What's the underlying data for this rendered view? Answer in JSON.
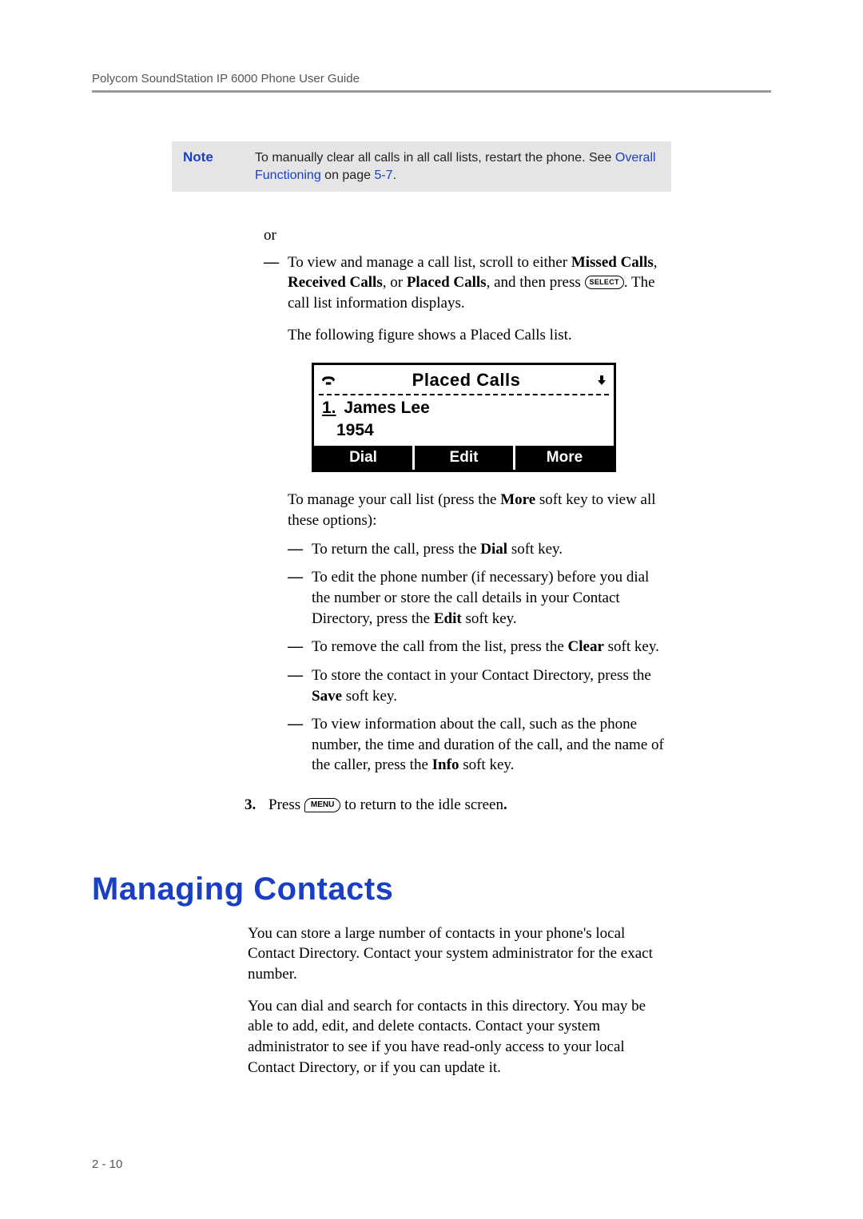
{
  "header": "Polycom SoundStation IP 6000 Phone User Guide",
  "note": {
    "label": "Note",
    "text_part1": "To manually clear all calls in all call lists, restart the phone. See ",
    "link1": "Overall Functioning",
    "text_part2": " on page ",
    "link2": "5-7",
    "text_part3": "."
  },
  "or_text": "or",
  "dash1": {
    "part1": "To view and manage a call list, scroll to either ",
    "b1": "Missed Calls",
    "part2": ", ",
    "b2": "Received Calls",
    "part3": ", or ",
    "b3": "Placed Calls",
    "part4": ", and then press ",
    "select_key": "SELECT",
    "part5": ". The call list information displays."
  },
  "fig_intro": "The following figure shows a Placed Calls list.",
  "screen": {
    "title": "Placed Calls",
    "entry_index": "1.",
    "entry_name": " James Lee",
    "entry_number": "1954",
    "softkeys": [
      "Dial",
      "Edit",
      "More"
    ]
  },
  "manage_intro": {
    "part1": "To manage your call list (press the ",
    "b1": "More",
    "part2": " soft key to view all these options):"
  },
  "mlist": [
    {
      "p1": "To return the call, press the ",
      "b": "Dial",
      "p2": " soft key."
    },
    {
      "p1": "To edit the phone number (if necessary) before you dial the number or store the call details in your Contact Directory, press the ",
      "b": "Edit",
      "p2": " soft key."
    },
    {
      "p1": "To remove the call from the list, press the ",
      "b": "Clear",
      "p2": " soft key."
    },
    {
      "p1": "To store the contact in your Contact Directory, press the ",
      "b": "Save",
      "p2": " soft key."
    },
    {
      "p1": "To view information about the call, such as the phone number, the time and duration of the call, and the name of the caller, press the ",
      "b": "Info",
      "p2": " soft key."
    }
  ],
  "step3": {
    "num": "3.",
    "p1": "Press ",
    "key": "MENU",
    "p2": " to return to the idle screen",
    "p3": "."
  },
  "h1": "Managing Contacts",
  "mc_para1": "You can store a large number of contacts in your phone's local Contact Directory. Contact your system administrator for the exact number.",
  "mc_para2": "You can dial and search for contacts in this directory. You may be able to add, edit, and delete contacts. Contact your system administrator to see if you have read-only access to your local Contact Directory, or if you can update it.",
  "page_num": "2 - 10"
}
